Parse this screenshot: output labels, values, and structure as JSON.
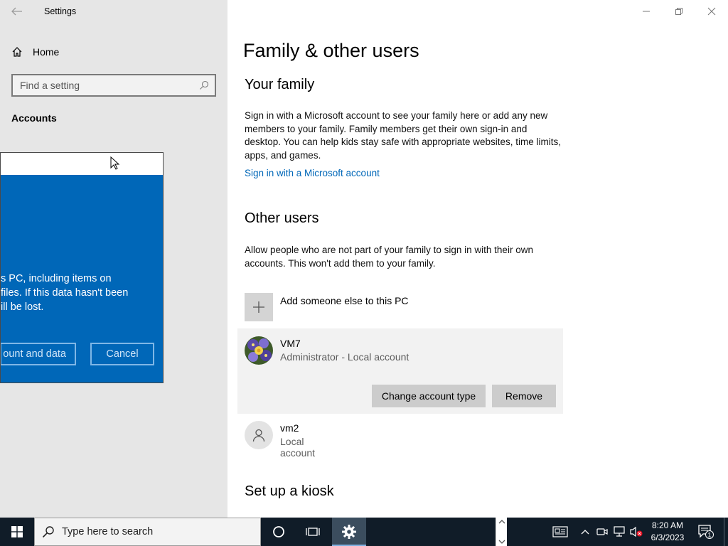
{
  "window": {
    "title": "Settings"
  },
  "nav": {
    "home_label": "Home",
    "search_placeholder": "Find a setting",
    "section": "Accounts"
  },
  "dialog": {
    "message": "s PC, including items on\nfiles. If this data hasn't been\nill be lost.",
    "delete_label": "ount and data",
    "cancel_label": "Cancel",
    "accent_color": "#0067b8"
  },
  "main": {
    "title": "Family & other users",
    "family": {
      "heading": "Your family",
      "description": "Sign in with a Microsoft account to see your family here or add any new members to your family. Family members get their own sign-in and desktop. You can help kids stay safe with appropriate websites, time limits, apps, and games.",
      "link": "Sign in with a Microsoft account"
    },
    "other": {
      "heading": "Other users",
      "description": "Allow people who are not part of your family to sign in with their own accounts. This won't add them to your family.",
      "add_label": "Add someone else to this PC",
      "users": [
        {
          "name": "VM7",
          "detail": "Administrator - Local account",
          "change_label": "Change account type",
          "remove_label": "Remove"
        },
        {
          "name": "vm2",
          "detail": "Local account"
        }
      ]
    },
    "kiosk_heading": "Set up a kiosk"
  },
  "taskbar": {
    "search_placeholder": "Type here to search",
    "time": "8:20 AM",
    "date": "6/3/2023",
    "notification_count": "1"
  }
}
